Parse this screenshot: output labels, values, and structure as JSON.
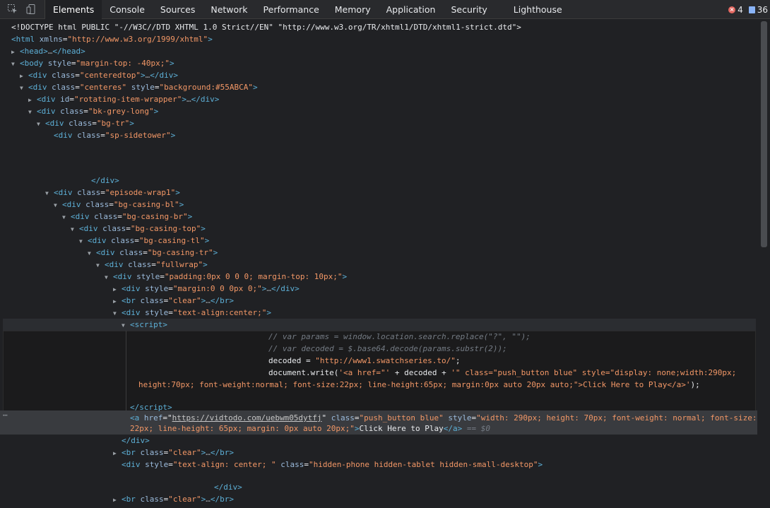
{
  "toolbar": {
    "tabs": [
      {
        "label": "Elements"
      },
      {
        "label": "Console"
      },
      {
        "label": "Sources"
      },
      {
        "label": "Network"
      },
      {
        "label": "Performance"
      },
      {
        "label": "Memory"
      },
      {
        "label": "Application"
      },
      {
        "label": "Security"
      },
      {
        "label": "Lighthouse"
      }
    ],
    "error_count": "4",
    "message_count": "36",
    "error_color": "#e46962",
    "info_color": "#8ab4f8"
  },
  "icons": {
    "inspect": "inspect-element-icon",
    "device": "device-toolbar-icon"
  },
  "dom": {
    "l1": {
      "text": "<!DOCTYPE html PUBLIC \"-//W3C//DTD XHTML 1.0 Strict//EN\" \"http://www.w3.org/TR/xhtml1/DTD/xhtml1-strict.dtd\">"
    },
    "l2": {
      "tag": "html",
      "attr": "xmlns",
      "val": "\"http://www.w3.org/1999/xhtml\""
    },
    "l3": {
      "tag": "head",
      "close": "head"
    },
    "l4": {
      "tag": "body",
      "attr": "style",
      "val": "\"margin-top: -40px;\""
    },
    "l5": {
      "tag": "div",
      "attr": "class",
      "val": "\"centeredtop\"",
      "close": "div"
    },
    "l6": {
      "tag": "div",
      "attr": "class",
      "val": "\"centeres\"",
      "attr2": "style",
      "val2": "\"background:#55ABCA\""
    },
    "l7": {
      "tag": "div",
      "attr": "id",
      "val": "\"rotating-item-wrapper\"",
      "close": "div"
    },
    "l8": {
      "tag": "div",
      "attr": "class",
      "val": "\"bk-grey-long\""
    },
    "l9": {
      "tag": "div",
      "attr": "class",
      "val": "\"bg-tr\""
    },
    "l10": {
      "tag": "div",
      "attr": "class",
      "val": "\"sp-sidetower\""
    },
    "l11": {
      "close": "div"
    },
    "l12": {
      "tag": "div",
      "attr": "class",
      "val": "\"episode-wrap1\""
    },
    "l13": {
      "tag": "div",
      "attr": "class",
      "val": "\"bg-casing-bl\""
    },
    "l14": {
      "tag": "div",
      "attr": "class",
      "val": "\"bg-casing-br\""
    },
    "l15": {
      "tag": "div",
      "attr": "class",
      "val": "\"bg-casing-top\""
    },
    "l16": {
      "tag": "div",
      "attr": "class",
      "val": "\"bg-casing-tl\""
    },
    "l17": {
      "tag": "div",
      "attr": "class",
      "val": "\"bg-casing-tr\""
    },
    "l18": {
      "tag": "div",
      "attr": "class",
      "val": "\"fullwrap\""
    },
    "l19": {
      "tag": "div",
      "attr": "style",
      "val": "\"padding:0px 0 0 0; margin-top: 10px;\""
    },
    "l20": {
      "tag": "div",
      "attr": "style",
      "val": "\"margin:0 0 0px 0;\"",
      "close": "div"
    },
    "l21": {
      "tag": "br",
      "attr": "class",
      "val": "\"clear\"",
      "close": "br"
    },
    "l22": {
      "tag": "div",
      "attr": "style",
      "val": "\"text-align:center;\""
    },
    "l23": {
      "tag": "script"
    },
    "s1": "// var params = window.location.search.replace(\"?\", \"\");",
    "s2": "// var decoded = $.base64.decode(params.substr(2));",
    "s3": {
      "code": "decoded = ",
      "str": "\"http://www1.swatchseries.to/\"",
      "end": ";"
    },
    "s4": {
      "code": "document.",
      "fn": "write",
      "open": "(",
      "str1": "'<a href=\"'",
      "plus1": " + decoded + ",
      "str2": "'\" class=\"push_button blue\" style=\"display: none;width:290px;"
    },
    "s5": {
      "str": "height:70px; font-weight:normal; font-size:22px; line-height:65px; margin:0px auto 20px auto;\">Click Here to Play</a>'",
      "end": ");"
    },
    "l24": {
      "close": "script"
    },
    "a": {
      "tag": "a",
      "href_attr": "href",
      "href": "https://vidtodo.com/uebwm05dytfj",
      "attr2": "class",
      "val2": "\"push_button blue\"",
      "attr3": "style",
      "val3": "\"width: 290px; height: 70px; font-weight: normal; font-size:",
      "val3b": "22px; line-height: 65px; margin: 0px auto 20px;\"",
      "text": "Click Here to Play",
      "marker": " == $0"
    },
    "l25": {
      "close": "div"
    },
    "l26": {
      "tag": "br",
      "attr": "class",
      "val": "\"clear\"",
      "close": "br"
    },
    "l27": {
      "tag": "div",
      "attr": "style",
      "val": "\"text-align: center; \"",
      "attr2": "class",
      "val2": "\"hidden-phone hidden-tablet hidden-small-desktop\""
    },
    "l28": {
      "close": "div"
    },
    "l29": {
      "tag": "br",
      "attr": "class",
      "val": "\"clear\"",
      "close": "br"
    }
  }
}
